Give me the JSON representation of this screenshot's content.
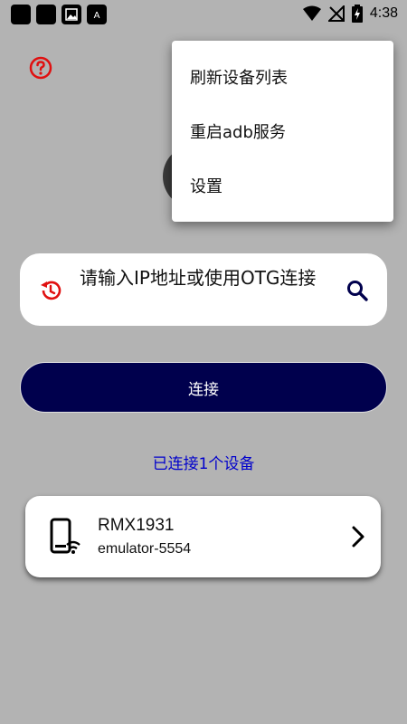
{
  "status_bar": {
    "time": "4:38",
    "icons": [
      "notification-square-icon",
      "notification-square-icon",
      "image-icon",
      "app-notification-icon",
      "wifi-icon",
      "no-signal-icon",
      "battery-charging-icon"
    ]
  },
  "help": {
    "icon": "help-circle-icon",
    "color": "#e01010"
  },
  "menu": {
    "items": [
      {
        "label": "刷新设备列表"
      },
      {
        "label": "重启adb服务"
      },
      {
        "label": "设置"
      }
    ]
  },
  "search": {
    "placeholder": "请输入IP地址或使用OTG连接",
    "history_icon": "history-icon",
    "search_icon": "search-icon"
  },
  "connect_button": {
    "label": "连接"
  },
  "status": {
    "connected_text": "已连接1个设备"
  },
  "devices": [
    {
      "name": "RMX1931",
      "serial": "emulator-5554",
      "icon": "phone-wifi-icon"
    }
  ],
  "colors": {
    "background": "#b3b3b3",
    "accent_red": "#e01010",
    "navy": "#00004d",
    "link_blue": "#0000cc"
  }
}
